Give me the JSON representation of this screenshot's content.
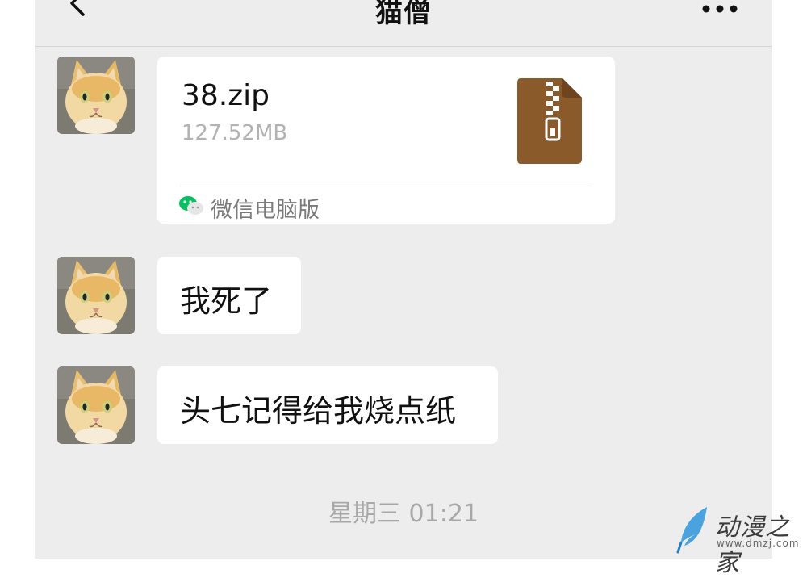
{
  "header": {
    "title": "猫僧",
    "back_icon": "chevron-left-icon",
    "more_icon": "more-dots-icon"
  },
  "messages": [
    {
      "type": "file",
      "file_name": "38.zip",
      "file_size": "127.52MB",
      "source_label": "微信电脑版",
      "file_icon": "zip-archive-icon",
      "file_icon_color": "#8b5a2b"
    },
    {
      "type": "text",
      "text": "我死了"
    },
    {
      "type": "text",
      "text": "头七记得给我烧点纸"
    }
  ],
  "timestamp": "星期三 01:21",
  "watermark": {
    "name": "动漫之家",
    "url": "www.dmzj.com"
  },
  "colors": {
    "chat_background": "#ededed",
    "bubble": "#ffffff",
    "wechat_green": "#07c160"
  }
}
